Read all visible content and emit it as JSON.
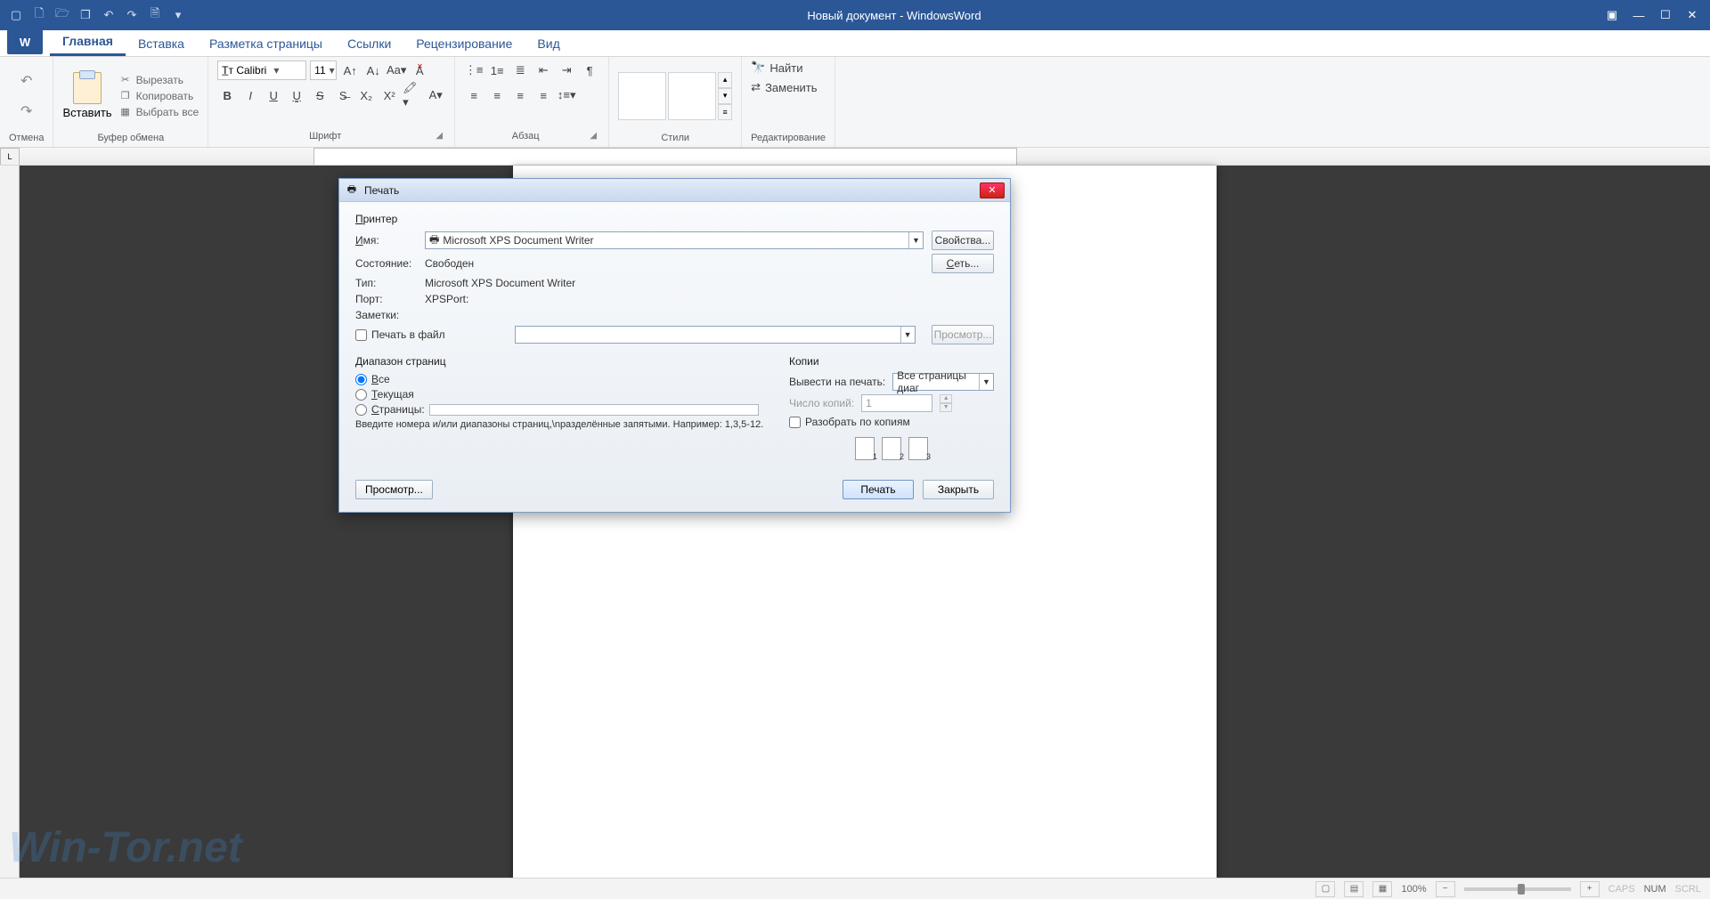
{
  "titlebar": {
    "title": "Новый документ - WindowsWord"
  },
  "tabs": {
    "home": "Главная",
    "insert": "Вставка",
    "layout": "Разметка страницы",
    "refs": "Ссылки",
    "review": "Рецензирование",
    "view": "Вид"
  },
  "ribbon": {
    "undo_group": "Отмена",
    "clipboard": {
      "label": "Буфер обмена",
      "paste": "Вставить",
      "cut": "Вырезать",
      "copy": "Копировать",
      "select_all": "Выбрать все"
    },
    "font": {
      "label": "Шрифт",
      "name": "Calibri",
      "size": "11"
    },
    "paragraph": {
      "label": "Абзац"
    },
    "styles": {
      "label": "Стили"
    },
    "editing": {
      "label": "Редактирование",
      "find": "Найти",
      "replace": "Заменить"
    }
  },
  "dialog": {
    "title": "Печать",
    "printer": {
      "section": "Принтер",
      "name_label": "Имя:",
      "name_value": "Microsoft XPS Document Writer",
      "properties": "Свойства...",
      "network": "Сеть...",
      "status_label": "Состояние:",
      "status_value": "Свободен",
      "type_label": "Тип:",
      "type_value": "Microsoft XPS Document Writer",
      "port_label": "Порт:",
      "port_value": "XPSPort:",
      "notes_label": "Заметки:",
      "print_to_file": "Печать в файл",
      "browse": "Просмотр..."
    },
    "range": {
      "section": "Диапазон страниц",
      "all": "Все",
      "current": "Текущая",
      "pages": "Страницы:",
      "hint": "Введите номера и/или диапазоны страниц,\\nразделённые запятыми. Например: 1,3,5-12."
    },
    "copies": {
      "section": "Копии",
      "output_label": "Вывести на печать:",
      "output_value": "Все страницы диаг",
      "count_label": "Число копий:",
      "count_value": "1",
      "collate": "Разобрать по копиям"
    },
    "footer": {
      "preview": "Просмотр...",
      "print": "Печать",
      "close": "Закрыть"
    }
  },
  "status": {
    "zoom": "100%",
    "caps": "CAPS",
    "num": "NUM",
    "scrl": "SCRL"
  },
  "watermark": "Win-Tor.net"
}
